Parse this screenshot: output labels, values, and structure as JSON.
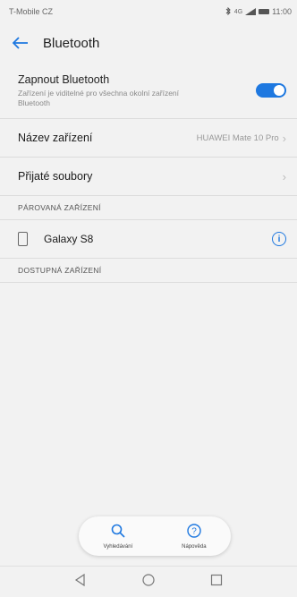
{
  "status_bar": {
    "carrier": "T-Mobile CZ",
    "time": "11:00",
    "network": "4G"
  },
  "app_bar": {
    "title": "Bluetooth"
  },
  "toggle": {
    "label": "Zapnout Bluetooth",
    "description": "Zařízení je viditelné pro všechna okolní zařízení Bluetooth",
    "state": "on",
    "accent_color": "#1e78e0"
  },
  "device_name": {
    "label": "Název zařízení",
    "value": "HUAWEI Mate 10 Pro"
  },
  "received_files": {
    "label": "Přijaté soubory"
  },
  "paired_section": {
    "title": "PÁROVANÁ ZAŘÍZENÍ",
    "devices": [
      {
        "name": "Galaxy S8"
      }
    ]
  },
  "available_section": {
    "title": "DOSTUPNÁ ZAŘÍZENÍ"
  },
  "bottom_actions": {
    "search_label": "Vyhledávání",
    "help_label": "Nápověda"
  },
  "nav": {
    "back": "back-triangle",
    "home": "home-circle",
    "recents": "recents-square"
  }
}
